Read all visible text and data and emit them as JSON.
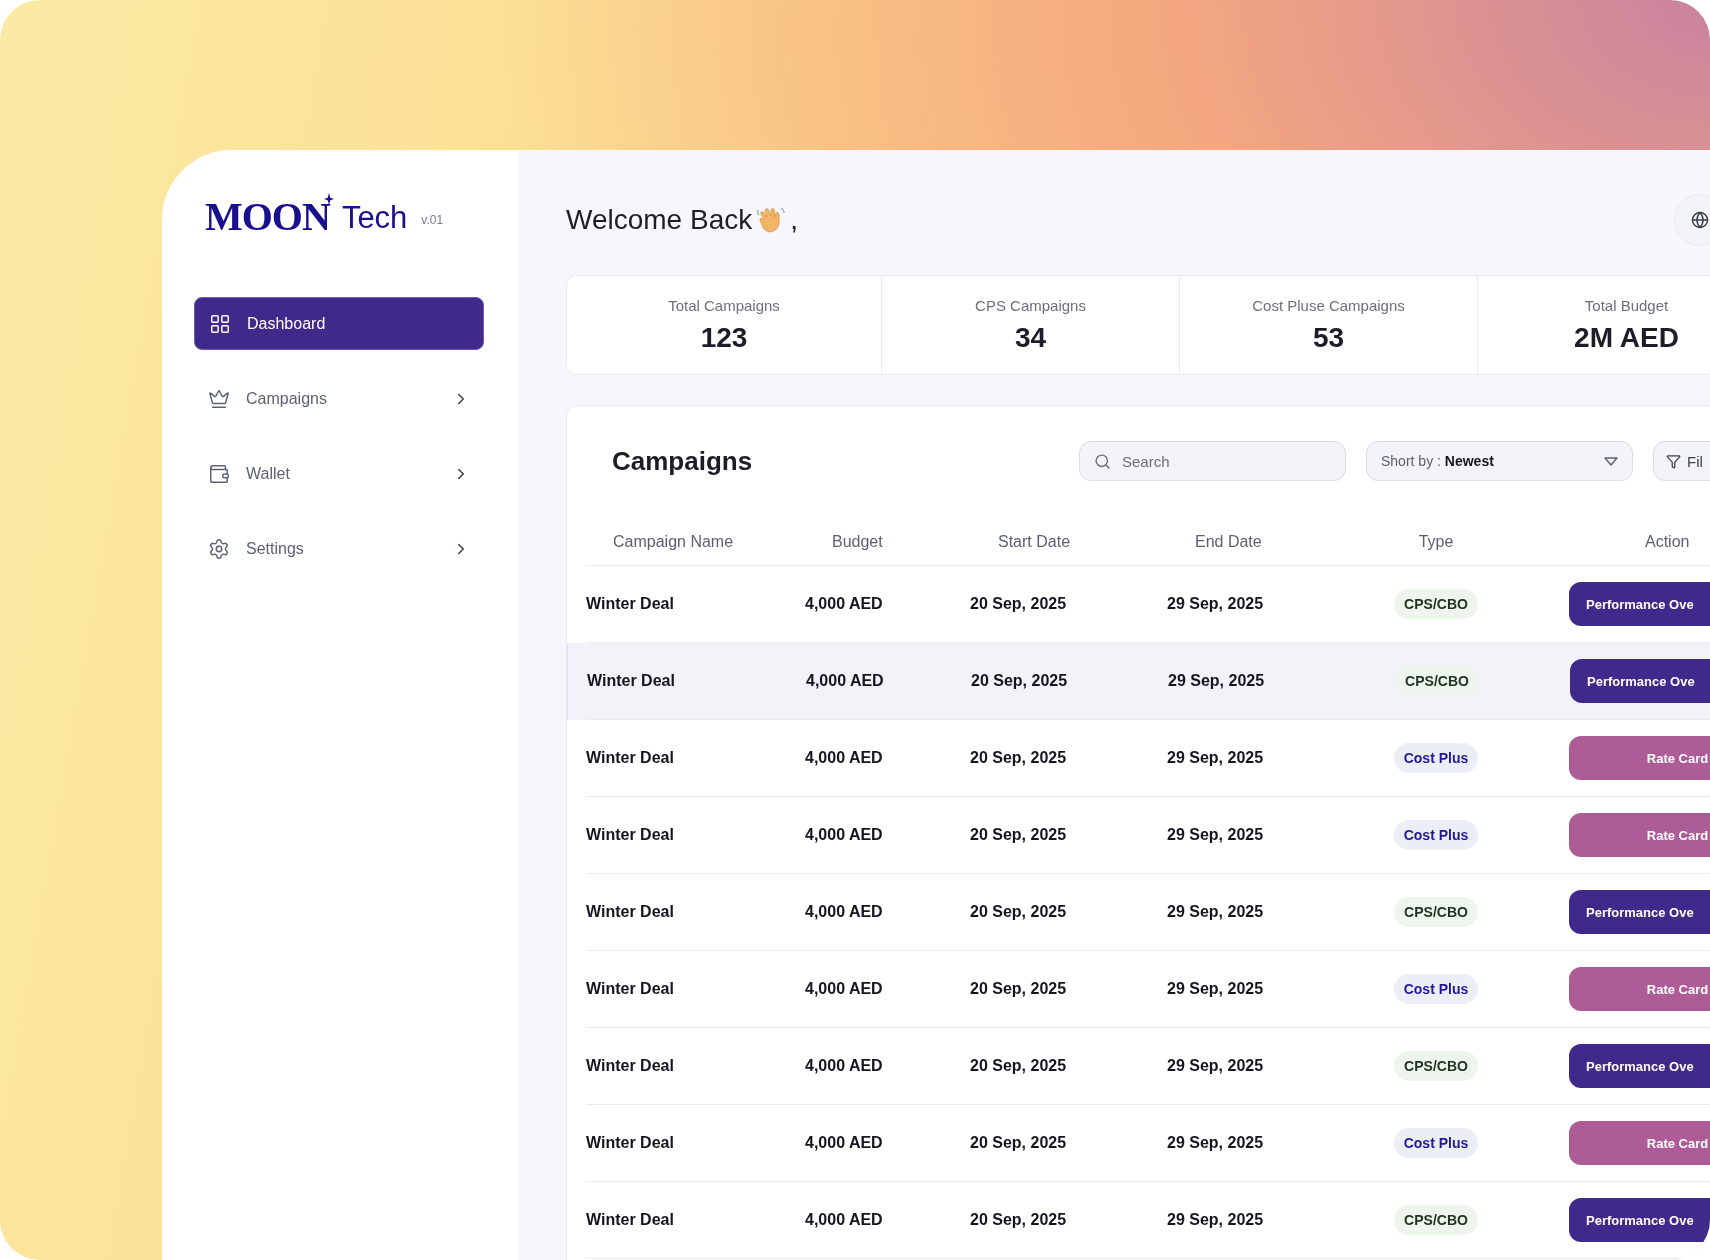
{
  "logo": {
    "brand": "MOON",
    "suffix": "Tech",
    "version": "v.01"
  },
  "sidebar": {
    "items": [
      {
        "label": "Dashboard",
        "kind": "grid",
        "selected": true,
        "expandable": false
      },
      {
        "label": "Campaigns",
        "kind": "crown",
        "selected": false,
        "expandable": true
      },
      {
        "label": "Wallet",
        "kind": "wallet",
        "selected": false,
        "expandable": true
      },
      {
        "label": "Settings",
        "kind": "gear",
        "selected": false,
        "expandable": true
      }
    ]
  },
  "header": {
    "greeting": "Welcome Back",
    "punctuation": ","
  },
  "stats": [
    {
      "label": "Total Campaigns",
      "value": "123"
    },
    {
      "label": "CPS Campaigns",
      "value": "34"
    },
    {
      "label": "Cost Pluse Campaigns",
      "value": "53"
    },
    {
      "label": "Total Budget",
      "value": "2M AED"
    }
  ],
  "campaigns": {
    "title": "Campaigns",
    "search": {
      "placeholder": "Search"
    },
    "sort": {
      "text": "Short by : **Newest**"
    },
    "filter": {
      "label": "Fil"
    },
    "columns": [
      "Campaign Name",
      "Budget",
      "Start Date",
      "End Date",
      "Type",
      "Action"
    ],
    "rows": [
      {
        "name": "Winter Deal",
        "budget": "4,000 AED",
        "start": "20 Sep, 2025",
        "end": "29 Sep, 2025",
        "type": {
          "label": "CPS/CBO",
          "kind": "cps"
        },
        "action": {
          "label": "Performance Ove",
          "kind": "performance"
        },
        "highlighted": false
      },
      {
        "name": "Winter Deal",
        "budget": "4,000 AED",
        "start": "20 Sep, 2025",
        "end": "29 Sep, 2025",
        "type": {
          "label": "CPS/CBO",
          "kind": "cps"
        },
        "action": {
          "label": "Performance Ove",
          "kind": "performance"
        },
        "highlighted": true
      },
      {
        "name": "Winter Deal",
        "budget": "4,000 AED",
        "start": "20 Sep, 2025",
        "end": "29 Sep, 2025",
        "type": {
          "label": "Cost Plus",
          "kind": "cost_plus"
        },
        "action": {
          "label": "Rate Card",
          "kind": "rate"
        },
        "highlighted": false
      },
      {
        "name": "Winter Deal",
        "budget": "4,000 AED",
        "start": "20 Sep, 2025",
        "end": "29 Sep, 2025",
        "type": {
          "label": "Cost Plus",
          "kind": "cost_plus"
        },
        "action": {
          "label": "Rate Card",
          "kind": "rate"
        },
        "highlighted": false
      },
      {
        "name": "Winter Deal",
        "budget": "4,000 AED",
        "start": "20 Sep, 2025",
        "end": "29 Sep, 2025",
        "type": {
          "label": "CPS/CBO",
          "kind": "cps"
        },
        "action": {
          "label": "Performance Ove",
          "kind": "performance"
        },
        "highlighted": false
      },
      {
        "name": "Winter Deal",
        "budget": "4,000 AED",
        "start": "20 Sep, 2025",
        "end": "29 Sep, 2025",
        "type": {
          "label": "Cost Plus",
          "kind": "cost_plus"
        },
        "action": {
          "label": "Rate Card",
          "kind": "rate"
        },
        "highlighted": false
      },
      {
        "name": "Winter Deal",
        "budget": "4,000 AED",
        "start": "20 Sep, 2025",
        "end": "29 Sep, 2025",
        "type": {
          "label": "CPS/CBO",
          "kind": "cps"
        },
        "action": {
          "label": "Performance Ove",
          "kind": "performance"
        },
        "highlighted": false
      },
      {
        "name": "Winter Deal",
        "budget": "4,000 AED",
        "start": "20 Sep, 2025",
        "end": "29 Sep, 2025",
        "type": {
          "label": "Cost Plus",
          "kind": "cost_plus"
        },
        "action": {
          "label": "Rate Card",
          "kind": "rate"
        },
        "highlighted": false
      },
      {
        "name": "Winter Deal",
        "budget": "4,000 AED",
        "start": "20 Sep, 2025",
        "end": "29 Sep, 2025",
        "type": {
          "label": "CPS/CBO",
          "kind": "cps"
        },
        "action": {
          "label": "Performance Ove",
          "kind": "performance"
        },
        "highlighted": false
      }
    ]
  }
}
